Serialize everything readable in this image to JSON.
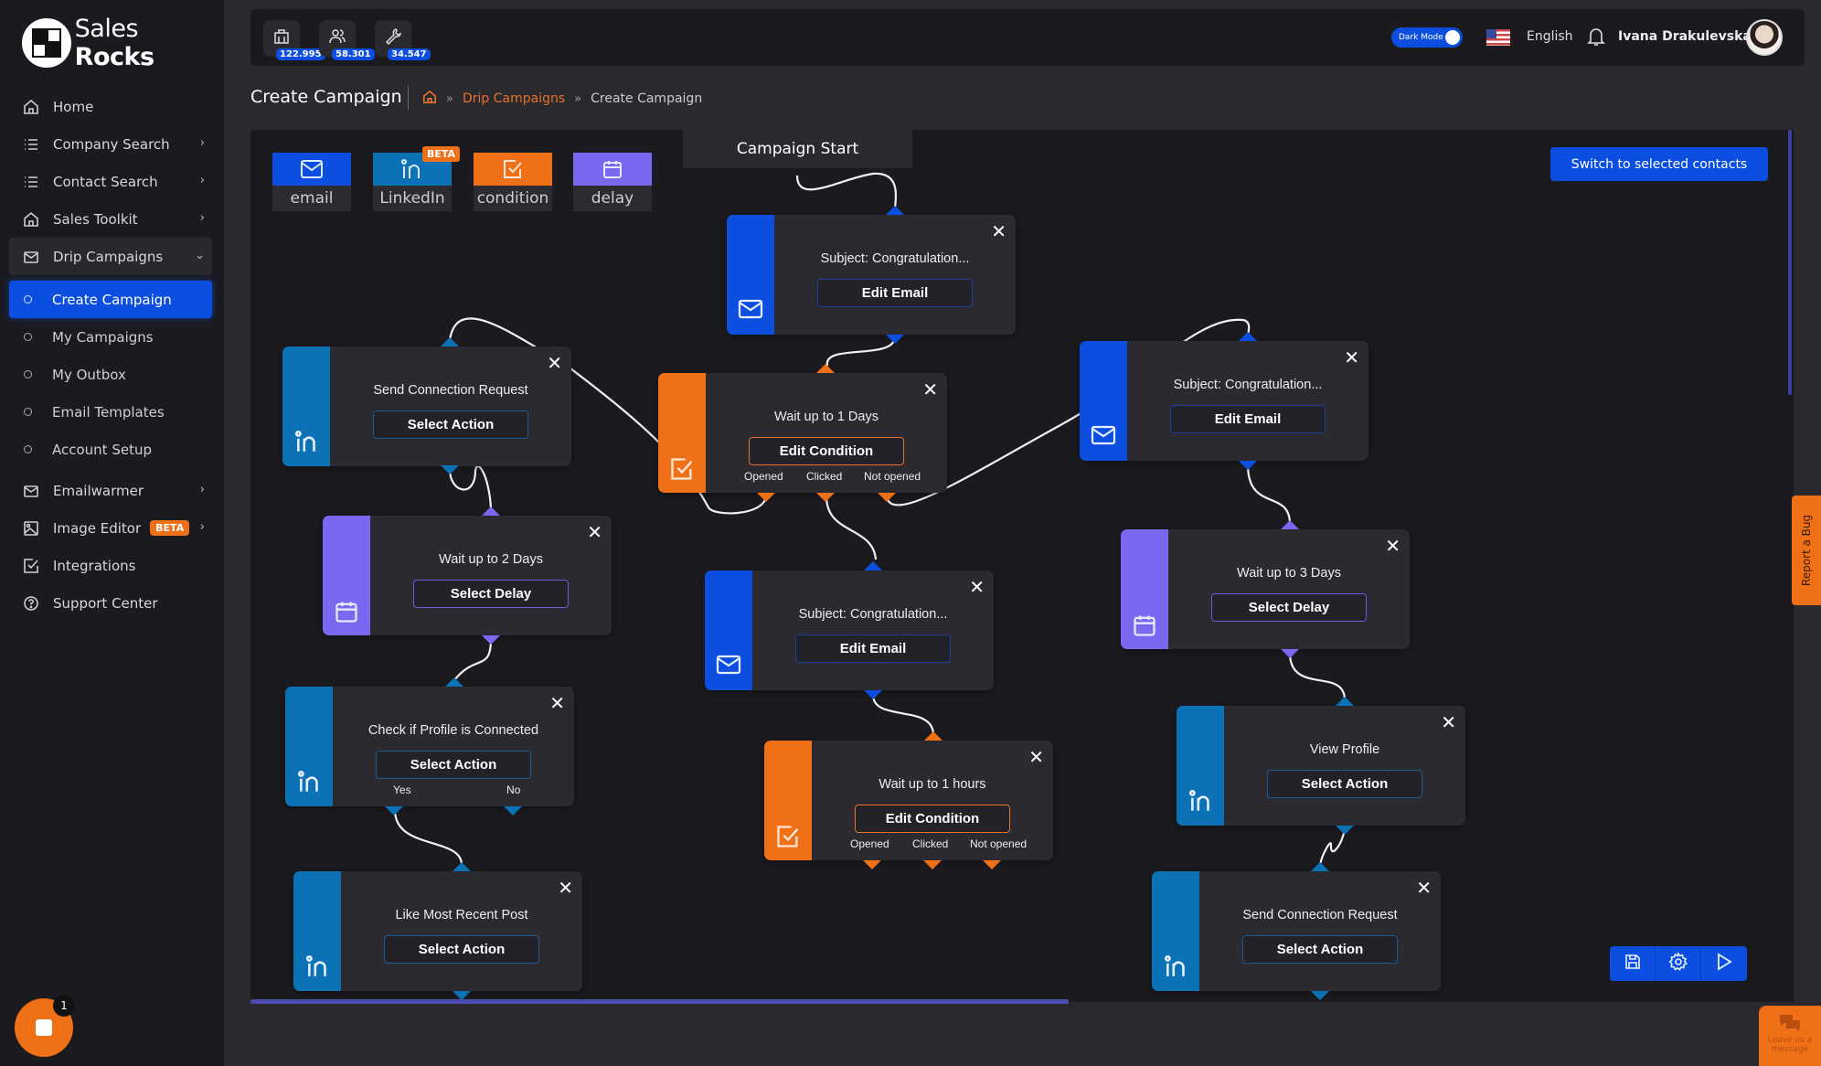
{
  "brand": {
    "name_light": "Sales ",
    "name_bold": "Rocks"
  },
  "sidebar": {
    "items": [
      {
        "label": "Home",
        "icon": "home-icon",
        "has_chevron": false
      },
      {
        "label": "Company Search",
        "icon": "list-icon",
        "has_chevron": true
      },
      {
        "label": "Contact Search",
        "icon": "list-icon",
        "has_chevron": true
      },
      {
        "label": "Sales Toolkit",
        "icon": "home-icon",
        "has_chevron": true
      },
      {
        "label": "Drip Campaigns",
        "icon": "mail-icon",
        "expanded": true
      }
    ],
    "sub_items": [
      {
        "label": "Create Campaign",
        "active": true
      },
      {
        "label": "My Campaigns"
      },
      {
        "label": "My Outbox"
      },
      {
        "label": "Email Templates"
      },
      {
        "label": "Account Setup"
      }
    ],
    "items_after": [
      {
        "label": "Emailwarmer",
        "icon": "mail-icon"
      },
      {
        "label": "Image Editor",
        "icon": "image-icon",
        "badge": "BETA"
      },
      {
        "label": "Integrations",
        "icon": "checkbox-icon"
      },
      {
        "label": "Support Center",
        "icon": "help-circle-icon"
      }
    ],
    "help_badge_count": "1"
  },
  "topbar": {
    "stats": [
      {
        "icon": "building-icon",
        "count": "122.995"
      },
      {
        "icon": "users-icon",
        "count": "58.301"
      },
      {
        "icon": "wrench-icon",
        "count": "34.547"
      }
    ],
    "dark_mode_label": "Dark Mode",
    "dark_mode_on": true,
    "language": "English",
    "user_name": "Ivana Drakulevska"
  },
  "page": {
    "title": "Create Campaign",
    "breadcrumb": [
      "Drip Campaigns",
      "Create Campaign"
    ],
    "breadcrumb_sep": "»"
  },
  "palette": [
    {
      "label": "email",
      "color": "#0c4fe0"
    },
    {
      "label": "LinkedIn",
      "color": "#0a72b5",
      "badge": "BETA"
    },
    {
      "label": "condition",
      "color": "#f07018"
    },
    {
      "label": "delay",
      "color": "#7a68f0"
    }
  ],
  "canvas": {
    "start_label": "Campaign Start",
    "switch_button": "Switch to selected contacts",
    "nodes": [
      {
        "id": "email1",
        "type": "email",
        "title": "Subject: Congratulation...",
        "button": "Edit Email"
      },
      {
        "id": "li1",
        "type": "linkedin",
        "title": "Send Connection Request",
        "button": "Select Action"
      },
      {
        "id": "cond1",
        "type": "condition",
        "title": "Wait up to 1 Days",
        "button": "Edit Condition",
        "outputs": [
          "Opened",
          "Clicked",
          "Not opened"
        ]
      },
      {
        "id": "email2",
        "type": "email",
        "title": "Subject: Congratulation...",
        "button": "Edit Email"
      },
      {
        "id": "delay1",
        "type": "delay",
        "title": "Wait up to 2 Days",
        "button": "Select Delay"
      },
      {
        "id": "email3",
        "type": "email",
        "title": "Subject: Congratulation...",
        "button": "Edit Email"
      },
      {
        "id": "delay2",
        "type": "delay",
        "title": "Wait up to 3 Days",
        "button": "Select Delay"
      },
      {
        "id": "li2",
        "type": "linkedin",
        "title": "Check if Profile is Connected",
        "button": "Select Action",
        "outputs": [
          "Yes",
          "No"
        ]
      },
      {
        "id": "cond2",
        "type": "condition",
        "title": "Wait up to 1 hours",
        "button": "Edit Condition",
        "outputs": [
          "Opened",
          "Clicked",
          "Not opened"
        ]
      },
      {
        "id": "li3",
        "type": "linkedin",
        "title": "View Profile",
        "button": "Select Action"
      },
      {
        "id": "li4",
        "type": "linkedin",
        "title": "Like Most Recent Post",
        "button": "Select Action"
      },
      {
        "id": "li5",
        "type": "linkedin",
        "title": "Send Connection Request",
        "button": "Select Action"
      }
    ],
    "close_glyph": "✕"
  },
  "side_tabs": {
    "report_bug": "Report a Bug",
    "leave_message": "Leave us a message"
  },
  "colors": {
    "email": "#0c4fe0",
    "linkedin": "#0a72b5",
    "condition": "#f07018",
    "delay": "#7a68f0",
    "accent": "#0c4fe0"
  }
}
